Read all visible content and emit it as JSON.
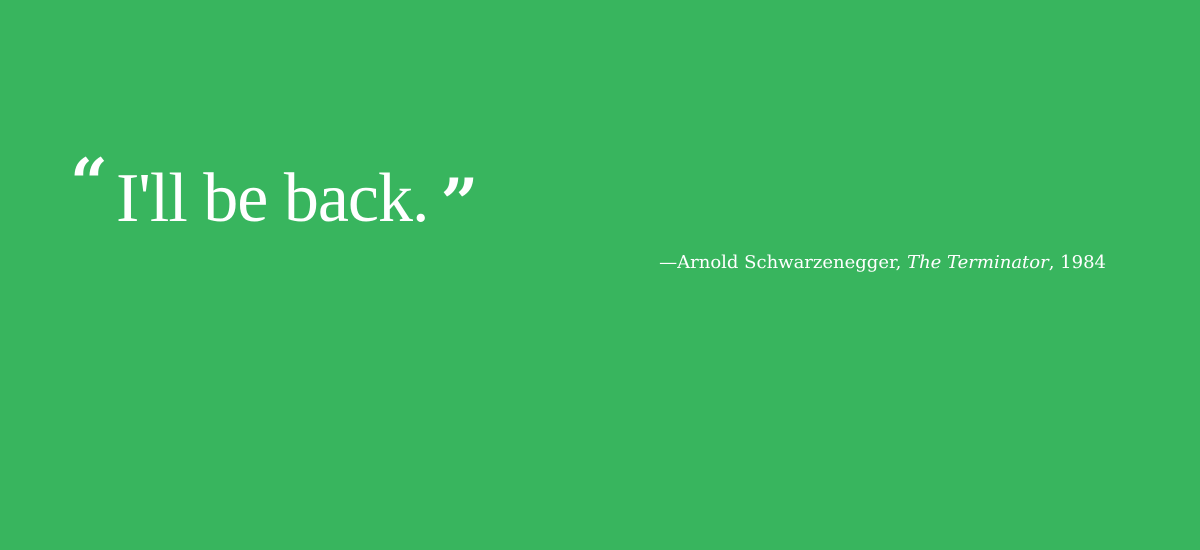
{
  "quote": {
    "open_mark": "“",
    "text": "I'll be back.",
    "close_mark": "”"
  },
  "attribution": {
    "prefix": "—Arnold Schwarzenegger, ",
    "film": "The Terminator",
    "suffix": ", 1984"
  },
  "colors": {
    "background": "#38b55e",
    "text": "#ffffff"
  }
}
